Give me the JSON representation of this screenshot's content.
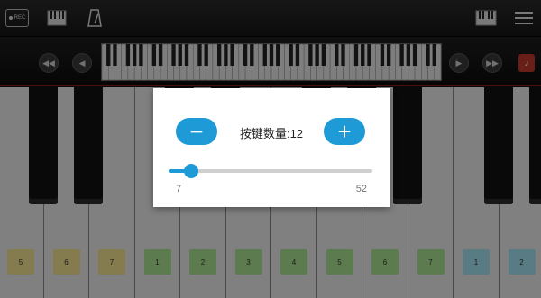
{
  "toolbar": {
    "rec_label": "REC",
    "icons": [
      "record-icon",
      "keyboard-icon",
      "metronome-icon",
      "keyboard-layout-icon",
      "menu-icon"
    ]
  },
  "navbar": {
    "icons": [
      "rewind-icon",
      "scroll-left-icon",
      "mini-keyboard",
      "scroll-right-icon",
      "fast-forward-icon",
      "settings-icon"
    ]
  },
  "piano": {
    "white_key_labels": [
      "5",
      "6",
      "7",
      "1",
      "2",
      "3",
      "4",
      "5",
      "6",
      "7",
      "1",
      "2"
    ],
    "label_colors": [
      "#f0e090",
      "#f0e090",
      "#f0e090",
      "#a8e090",
      "#a8e090",
      "#a8e090",
      "#a8e090",
      "#a8e090",
      "#a8e090",
      "#a8e090",
      "#a0e0f0",
      "#a0e0f0"
    ]
  },
  "dialog": {
    "title": "按键数量:12",
    "minus_label": "−",
    "plus_label": "+",
    "slider": {
      "min": 7,
      "max": 52,
      "value": 12
    },
    "min_label": "7",
    "max_label": "52"
  },
  "colors": {
    "accent": "#1e9bd7",
    "record_red": "#c0392b"
  }
}
